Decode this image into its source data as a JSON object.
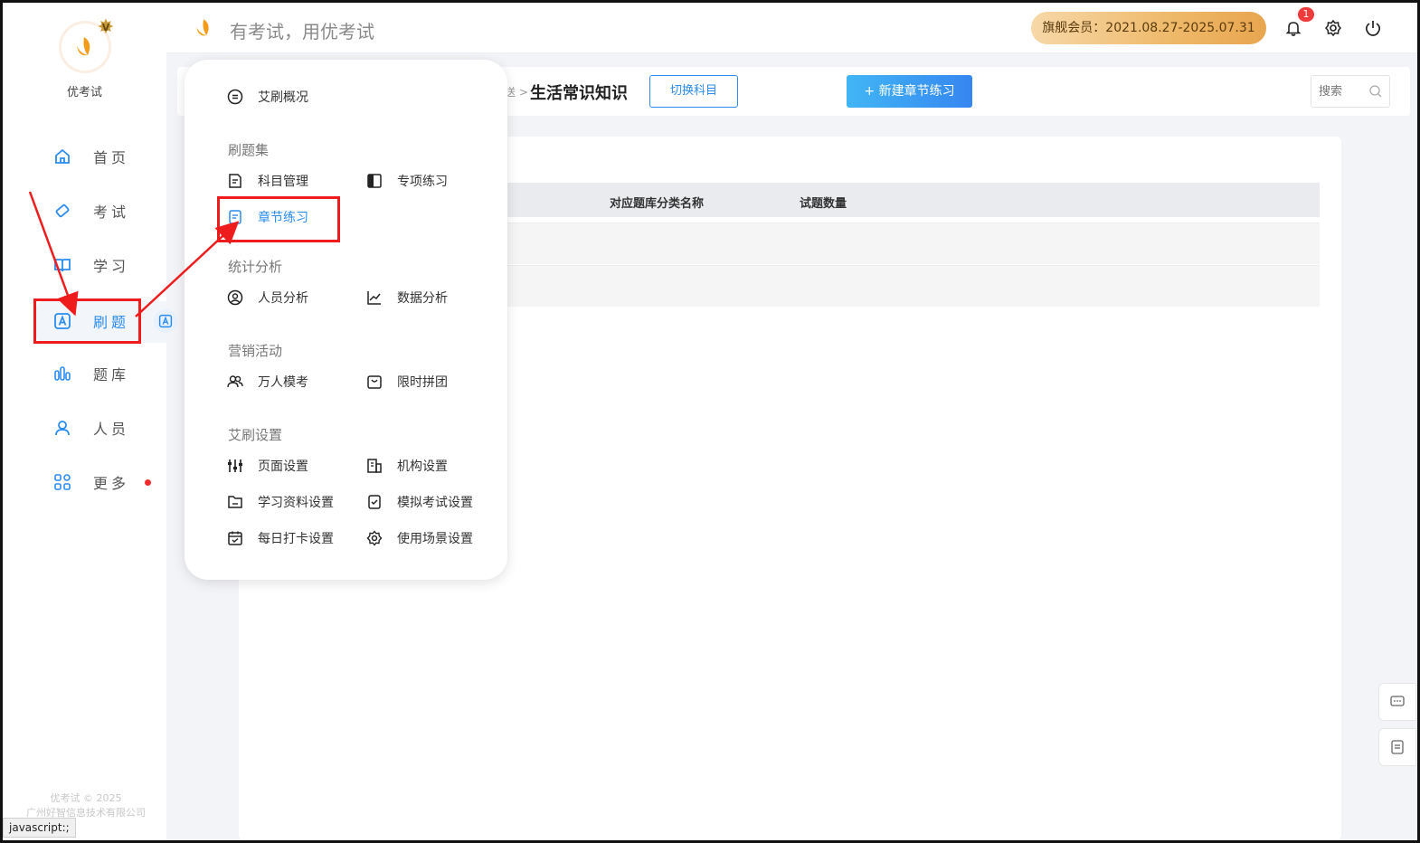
{
  "brand": {
    "name": "优考试",
    "vip_mark": "V"
  },
  "header": {
    "slogan": "有考试，用优考试",
    "membership": "旗舰会员：2021.08.27-2025.07.31",
    "notification_count": "1"
  },
  "sidebar": {
    "items": [
      {
        "label": "首页",
        "icon": "home-icon"
      },
      {
        "label": "考试",
        "icon": "eraser-icon"
      },
      {
        "label": "学习",
        "icon": "book-icon"
      },
      {
        "label": "刷题",
        "icon": "letter-a-icon",
        "active": true
      },
      {
        "label": "题库",
        "icon": "bar-chart-icon"
      },
      {
        "label": "人员",
        "icon": "user-icon"
      },
      {
        "label": "更多",
        "icon": "apps-icon",
        "has_dot": true
      }
    ],
    "footer_copyright": "优考试 © 2025",
    "footer_company": "广州好智信息技术有限公司"
  },
  "status_bar": {
    "text": "javascript:;"
  },
  "toolbar": {
    "breadcrumb_tail": "送 >",
    "title": "生活常识知识",
    "switch_label": "切换科目",
    "new_label": "+ 新建章节练习",
    "search_placeholder": "搜索"
  },
  "table": {
    "columns": [
      "对应题库分类名称",
      "试题数量"
    ]
  },
  "menu": {
    "overview": "艾刷概况",
    "sections": [
      {
        "title": "刷题集",
        "items": [
          "科目管理",
          "专项练习",
          "章节练习"
        ]
      },
      {
        "title": "统计分析",
        "items": [
          "人员分析",
          "数据分析"
        ]
      },
      {
        "title": "营销活动",
        "items": [
          "万人模考",
          "限时拼团"
        ]
      },
      {
        "title": "艾刷设置",
        "items": [
          "页面设置",
          "机构设置",
          "学习资料设置",
          "模拟考试设置",
          "每日打卡设置",
          "使用场景设置"
        ]
      }
    ],
    "active_item": "章节练习"
  },
  "colors": {
    "accent": "#2b8cf0",
    "annotation": "#ee1c1c",
    "gold": "#eeb96a"
  }
}
